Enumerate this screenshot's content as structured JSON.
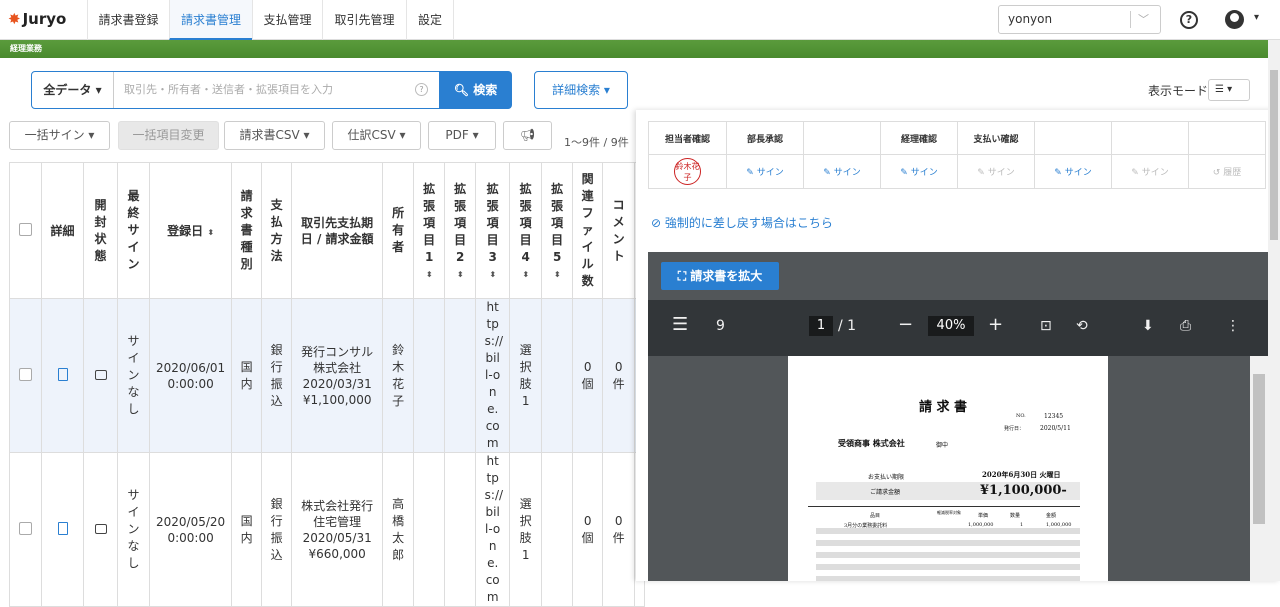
{
  "app": {
    "logo": "Juryo"
  },
  "nav": {
    "tabs": [
      "請求書登録",
      "請求書管理",
      "支払管理",
      "取引先管理",
      "設定"
    ],
    "active": 1,
    "user": "yonyon",
    "help_icon": "help-icon",
    "user_icon": "user-icon"
  },
  "banner": {
    "label": "経理業務"
  },
  "search": {
    "scope": "全データ ▾",
    "placeholder": "取引先・所有者・送信者・拡張項目を入力",
    "button": "検索",
    "advanced": "詳細検索 ▾"
  },
  "display_mode": {
    "label": "表示モード"
  },
  "toolbar": {
    "bulk_sign": "一括サイン ▾",
    "bulk_edit": "一括項目変更",
    "invoice_csv": "請求書CSV ▾",
    "journal_csv": "仕訳CSV ▾",
    "pdf": "PDF ▾",
    "count": "1〜9件 / 9件"
  },
  "table": {
    "headers": {
      "detail": "詳細",
      "opened": "開封状態",
      "final_sign": "最終サイン",
      "reg_date": "登録日",
      "invoice_type": "請求書種別",
      "pay_method": "支払方法",
      "partner": "取引先支払期日 / 請求金額",
      "owner": "所有者",
      "ext1": "拡張項目1",
      "ext2": "拡張項目2",
      "ext3": "拡張項目3",
      "ext4": "拡張項目4",
      "ext5": "拡張項目5",
      "files": "関連ファイル数",
      "comments": "コメント"
    },
    "rows": [
      {
        "final_sign": "サインなし",
        "reg_date": "2020/06/01 0:00:00",
        "invoice_type": "国内",
        "pay_method": "銀行振込",
        "partner": "発行コンサル株式会社",
        "due": "2020/03/31",
        "amount": "¥1,100,000",
        "owner": "鈴木花子",
        "ext3": "https://bill-one.com",
        "ext4": "選択肢1",
        "files": "0個",
        "comments": "0件"
      },
      {
        "final_sign": "サインなし",
        "reg_date": "2020/05/20 0:00:00",
        "invoice_type": "国内",
        "pay_method": "銀行振込",
        "partner": "株式会社発行住宅管理",
        "due": "2020/05/31",
        "amount": "¥660,000",
        "owner": "高橋太郎",
        "ext3": "https://bill-one.com",
        "ext4": "選択肢1",
        "files": "0個",
        "comments": "0件"
      }
    ]
  },
  "approval": {
    "headers": [
      "担当者確認",
      "部長承認",
      "",
      "経理確認",
      "支払い確認",
      "",
      "",
      ""
    ],
    "seal": "鈴木花子",
    "actions": [
      "",
      "サイン",
      "サイン",
      "サイン",
      "サイン",
      "サイン",
      "サイン",
      "履歴"
    ],
    "force_back": "強制的に差し戻す場合はこちら"
  },
  "viewer": {
    "expand": "請求書を拡大",
    "page_count": "9",
    "page": "1",
    "total": "/ 1",
    "zoom": "40%"
  },
  "document": {
    "title": "請 求 書",
    "no_label": "NO.",
    "no": "12345",
    "issue_label": "発行日：",
    "issue_date": "2020/5/11",
    "recipient": "受領商事 株式会社",
    "honorific": "御中",
    "due_label": "お支払い期限",
    "due": "2020年6月30日 火曜日",
    "amount_label": "ご請求金額",
    "amount": "¥1,100,000-",
    "cols": [
      "品目",
      "軽減税率対象",
      "単価",
      "数量",
      "金額"
    ],
    "item": [
      "3月分の業務委託料",
      "",
      "1,000,000",
      "1",
      "1,000,000"
    ]
  }
}
